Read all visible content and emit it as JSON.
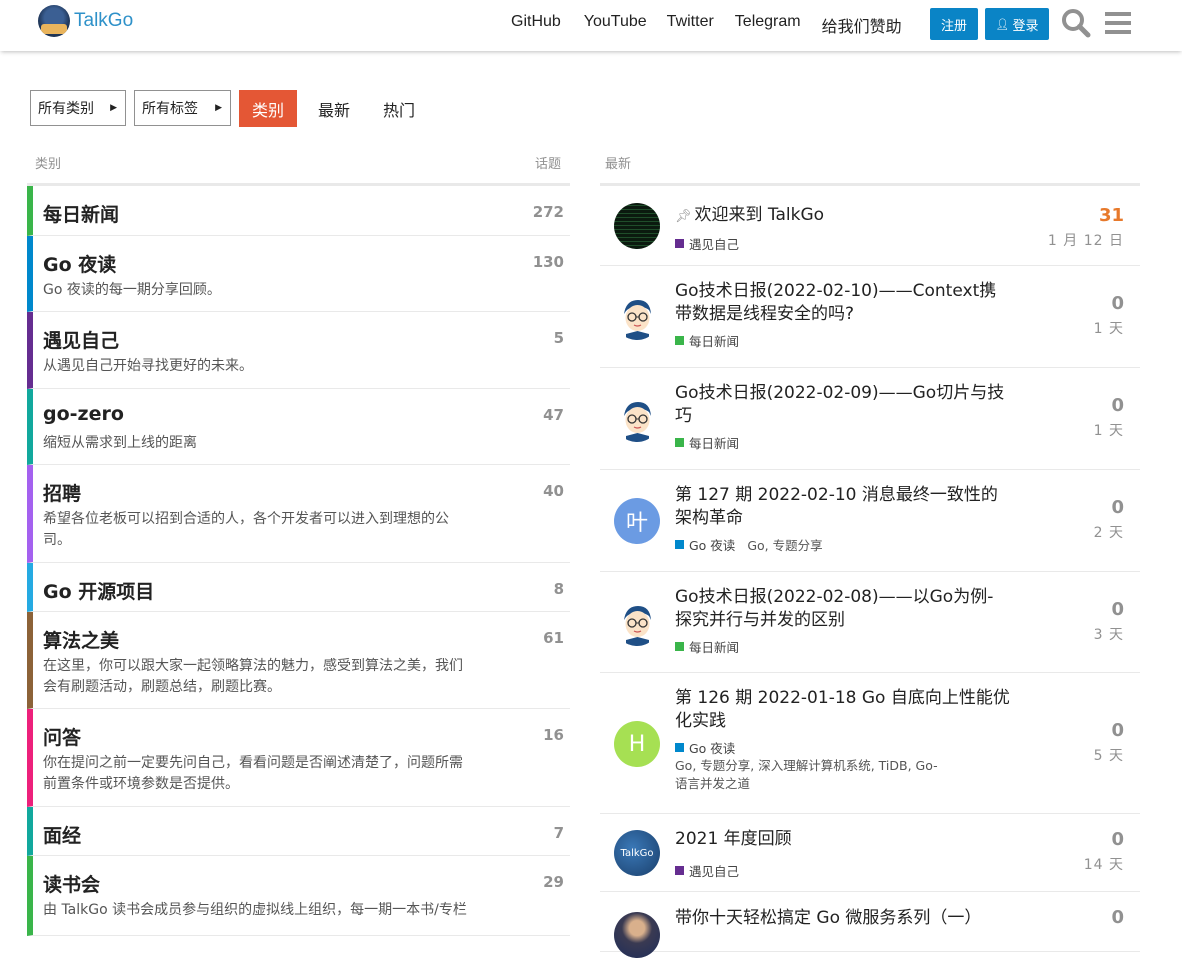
{
  "header": {
    "logo_text": "TalkGo",
    "nav_links": [
      "GitHub",
      "YouTube",
      "Twitter",
      "Telegram",
      "给我们赞助"
    ],
    "signup_label": "注册",
    "login_label": "登录",
    "accent_color": "#0a84c6"
  },
  "filters": {
    "all_categories": "所有类别",
    "all_tags": "所有标签",
    "tabs": [
      "类别",
      "最新",
      "热门"
    ],
    "active_tab_color": "#e45735"
  },
  "categories": {
    "col_title": "类别",
    "col_count": "话题",
    "rows": [
      {
        "name": "每日新闻",
        "desc": "",
        "count": "272",
        "color": "#3ab54a"
      },
      {
        "name": "Go 夜读",
        "desc": "Go 夜读的每一期分享回顾。",
        "count": "130",
        "color": "#0088cc"
      },
      {
        "name": "遇见自己",
        "desc": "从遇见自己开始寻找更好的未来。",
        "count": "5",
        "color": "#652d90"
      },
      {
        "name": "go-zero",
        "desc": "缩短从需求到上线的距离",
        "count": "47",
        "color": "#12a89d"
      },
      {
        "name": "招聘",
        "desc": "希望各位老板可以招到合适的人，各个开发者可以进入到理想的公司。",
        "count": "40",
        "color": "#a461ef"
      },
      {
        "name": "Go 开源项目",
        "desc": "",
        "count": "8",
        "color": "#25aae2"
      },
      {
        "name": "算法之美",
        "desc": "在这里，你可以跟大家一起领略算法的魅力，感受到算法之美，我们会有刷题活动，刷题总结，刷题比赛。",
        "count": "61",
        "color": "#8c6238"
      },
      {
        "name": "问答",
        "desc": "你在提问之前一定要先问自己，看看问题是否阐述清楚了，问题所需前置条件或环境参数是否提供。",
        "count": "16",
        "color": "#ed207b"
      },
      {
        "name": "面经",
        "desc": "",
        "count": "7",
        "color": "#12a89d"
      },
      {
        "name": "读书会",
        "desc": "由 TalkGo 读书会成员参与组织的虚拟线上组织，每一期一本书/专栏",
        "count": "29",
        "color": "#3ab54a"
      }
    ]
  },
  "latest": {
    "col_title": "最新",
    "topics": [
      {
        "title": "欢迎来到 TalkGo",
        "pinned": true,
        "category": "遇见自己",
        "cat_color": "#652d90",
        "tags": "",
        "tags2": "",
        "replies": "31",
        "hot": true,
        "age": "1 月 12 日",
        "avatar": "code"
      },
      {
        "title": "Go技术日报(2022-02-10)——Context携带数据是线程安全的吗?",
        "pinned": false,
        "category": "每日新闻",
        "cat_color": "#3ab54a",
        "tags": "",
        "tags2": "",
        "replies": "0",
        "hot": false,
        "age": "1 天",
        "avatar": "face"
      },
      {
        "title": "Go技术日报(2022-02-09)——Go切片与技巧",
        "pinned": false,
        "category": "每日新闻",
        "cat_color": "#3ab54a",
        "tags": "",
        "tags2": "",
        "replies": "0",
        "hot": false,
        "age": "1 天",
        "avatar": "face"
      },
      {
        "title": "第 127 期 2022-02-10 消息最终一致性的架构革命",
        "pinned": false,
        "category": "Go 夜读",
        "cat_color": "#0088cc",
        "tags": "Go, 专题分享",
        "tags2": "",
        "replies": "0",
        "hot": false,
        "age": "2 天",
        "avatar": "叶"
      },
      {
        "title": "Go技术日报(2022-02-08)——以Go为例-探究并行与并发的区别",
        "pinned": false,
        "category": "每日新闻",
        "cat_color": "#3ab54a",
        "tags": "",
        "tags2": "",
        "replies": "0",
        "hot": false,
        "age": "3 天",
        "avatar": "face"
      },
      {
        "title": "第 126 期 2022-01-18 Go 自底向上性能优化实践",
        "pinned": false,
        "category": "Go 夜读",
        "cat_color": "#0088cc",
        "tags": "",
        "tags2": "Go, 专题分享, 深入理解计算机系统, TiDB, Go-语言并发之道",
        "replies": "0",
        "hot": false,
        "age": "5 天",
        "avatar": "H"
      },
      {
        "title": "2021 年度回顾",
        "pinned": false,
        "category": "遇见自己",
        "cat_color": "#652d90",
        "tags": "",
        "tags2": "",
        "replies": "0",
        "hot": false,
        "age": "14 天",
        "avatar": "talkgo"
      },
      {
        "title": "带你十天轻松搞定 Go 微服务系列（一）",
        "pinned": false,
        "category": "",
        "cat_color": "",
        "tags": "",
        "tags2": "",
        "replies": "0",
        "hot": false,
        "age": "",
        "avatar": "photo"
      }
    ]
  }
}
